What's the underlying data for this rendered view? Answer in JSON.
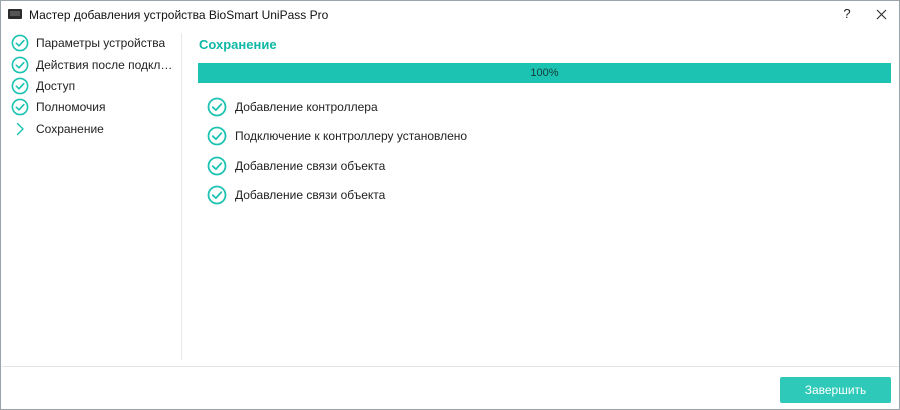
{
  "window": {
    "title": "Мастер добавления устройства BioSmart UniPass Pro",
    "help_label": "?",
    "accent_color": "#1cc3b2"
  },
  "sidebar": {
    "items": [
      {
        "label": "Параметры устройства",
        "icon": "check-circle-icon",
        "state": "done"
      },
      {
        "label": "Действия после подключения",
        "icon": "check-circle-icon",
        "state": "done"
      },
      {
        "label": "Доступ",
        "icon": "check-circle-icon",
        "state": "done"
      },
      {
        "label": "Полномочия",
        "icon": "check-circle-icon",
        "state": "done"
      },
      {
        "label": "Сохранение",
        "icon": "chevron-right-icon",
        "state": "current"
      }
    ]
  },
  "main": {
    "title": "Сохранение",
    "progress": {
      "percent": 100,
      "label": "100%"
    },
    "steps": [
      {
        "label": "Добавление контроллера",
        "icon": "check-circle-icon"
      },
      {
        "label": "Подключение к контроллеру установлено",
        "icon": "check-circle-icon"
      },
      {
        "label": "Добавление связи объекта",
        "icon": "check-circle-icon"
      },
      {
        "label": "Добавление связи объекта",
        "icon": "check-circle-icon"
      }
    ]
  },
  "footer": {
    "finish_label": "Завершить"
  }
}
